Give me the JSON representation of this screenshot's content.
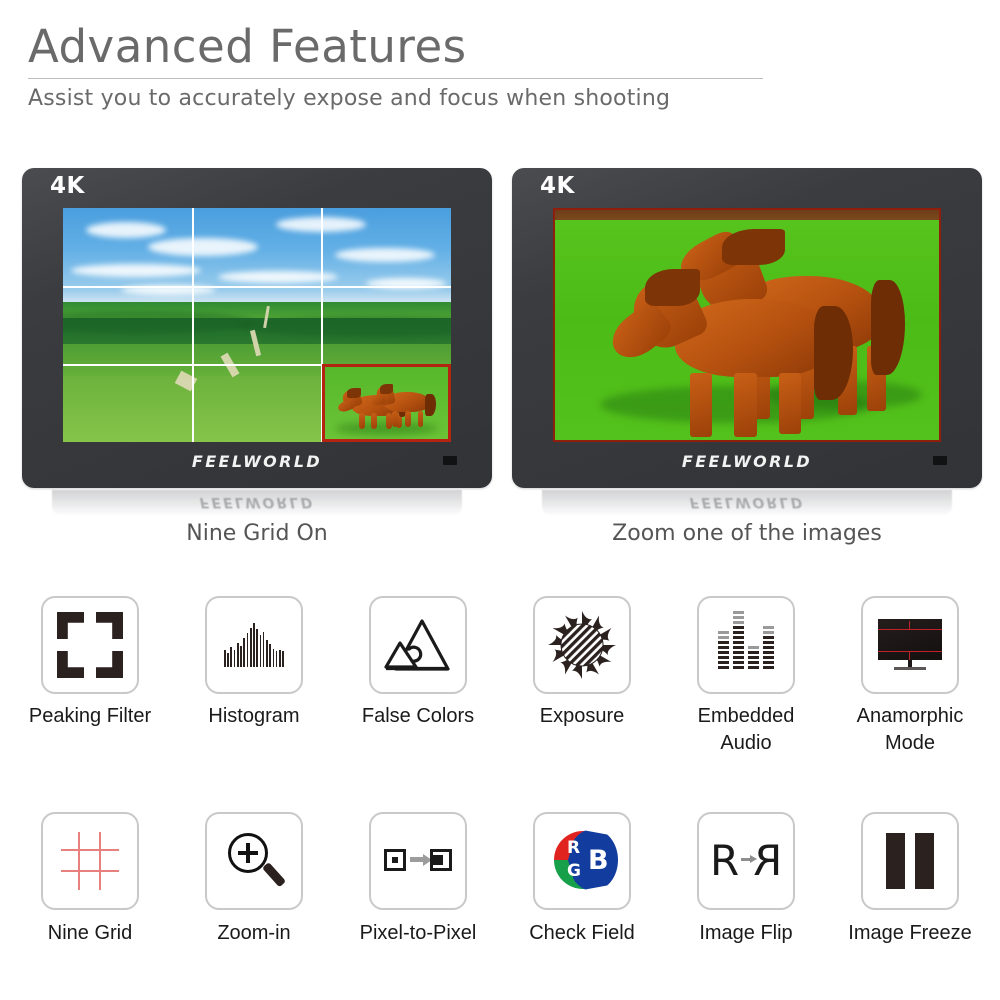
{
  "header": {
    "title": "Advanced Features",
    "subtitle": "Assist you to accurately expose and focus when shooting"
  },
  "monitors": [
    {
      "badge": "4K",
      "brand": "FEELW RLD",
      "brand_plain": "FEELWORLD",
      "caption": "Nine Grid On",
      "scene": "grassland-landscape-with-nine-grid-overlay-and-red-zoom-inset",
      "grid_color": "#ffffff",
      "inset_border_color": "#b52410"
    },
    {
      "badge": "4K",
      "brand": "FEELW RLD",
      "brand_plain": "FEELWORLD",
      "caption": "Zoom one of the images",
      "scene": "zoomed-horses-on-green-field",
      "screen_border_color": "#8f1f0c"
    }
  ],
  "features_row1": [
    {
      "label": "Peaking Filter",
      "icon": "peaking-filter-icon"
    },
    {
      "label": "Histogram",
      "icon": "histogram-icon"
    },
    {
      "label": "False Colors",
      "icon": "false-colors-icon"
    },
    {
      "label": "Exposure",
      "icon": "exposure-icon"
    },
    {
      "label": "Embedded\nAudio",
      "label_line1": "Embedded",
      "label_line2": "Audio",
      "icon": "embedded-audio-icon"
    },
    {
      "label": "Anamorphic\nMode",
      "label_line1": "Anamorphic",
      "label_line2": "Mode",
      "icon": "anamorphic-mode-icon"
    }
  ],
  "features_row2": [
    {
      "label": "Nine Grid",
      "icon": "nine-grid-icon"
    },
    {
      "label": "Zoom-in",
      "icon": "zoom-in-icon"
    },
    {
      "label": "Pixel-to-Pixel",
      "icon": "pixel-to-pixel-icon"
    },
    {
      "label": "Check Field",
      "icon": "check-field-icon",
      "channels": {
        "r": "R",
        "g": "G",
        "b": "B"
      }
    },
    {
      "label": "Image Flip",
      "icon": "image-flip-icon",
      "glyph": "R",
      "glyph_mirrored": "R"
    },
    {
      "label": "Image Freeze",
      "icon": "image-freeze-icon"
    }
  ],
  "colors": {
    "title_gray": "#6a6a6a",
    "icon_dark": "#2b211f",
    "tile_border": "#c9c9c9",
    "accent_red": "#c0212a",
    "grid_red": "#e8807e",
    "check_r": "#e0231f",
    "check_g": "#16a04a",
    "check_b": "#123d9e",
    "bezel": "#3a3c40"
  }
}
